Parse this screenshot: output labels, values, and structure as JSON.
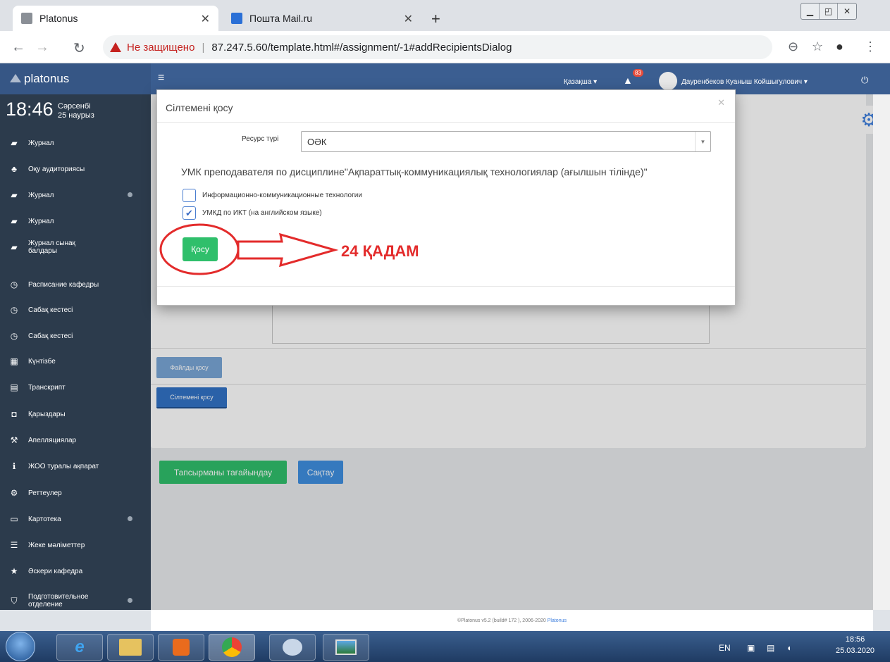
{
  "browser": {
    "tabs": [
      {
        "title": "Platonus",
        "active": true
      },
      {
        "title": "Пошта Mail.ru",
        "active": false
      }
    ],
    "address": {
      "warning": "Не защищено",
      "url": "87.247.5.60/template.html#/assignment/-1#addRecipientsDialog"
    }
  },
  "header": {
    "logo": "platonus",
    "language": "Қазақша ▾",
    "notifications_count": "83",
    "user": "Дауренбеков Куаныш Койшыгулович ▾"
  },
  "sidebar": {
    "time": "18:46",
    "weekday": "Сәрсенбі",
    "date": "25 наурыз",
    "items": [
      {
        "label": "Журнал",
        "icon": "book-icon"
      },
      {
        "label": "Оқу аудиториясы",
        "icon": "users-icon"
      },
      {
        "label": "Журнал",
        "icon": "book-icon"
      },
      {
        "label": "Журнал",
        "icon": "book-icon"
      },
      {
        "label": "Журнал сынақ балдары",
        "icon": "book-icon"
      },
      {
        "label": "Расписание кафедры",
        "icon": "clock-icon"
      },
      {
        "label": "Сабақ кестесі",
        "icon": "clock-icon"
      },
      {
        "label": "Сабақ кестесі",
        "icon": "clock-icon"
      },
      {
        "label": "Күнтізбе",
        "icon": "calendar-icon"
      },
      {
        "label": "Транскрипт",
        "icon": "table-icon"
      },
      {
        "label": "Қарыздары",
        "icon": "inbox-icon"
      },
      {
        "label": "Апелляциялар",
        "icon": "gavel-icon"
      },
      {
        "label": "ЖОО туралы ақпарат",
        "icon": "info-icon"
      },
      {
        "label": "Реттеулер",
        "icon": "cogs-icon"
      },
      {
        "label": "Картотека",
        "icon": "folder-icon"
      },
      {
        "label": "Жеке мәліметтер",
        "icon": "list-icon"
      },
      {
        "label": "Әскери кафедра",
        "icon": "star-icon"
      },
      {
        "label": "Подготовительное отделение",
        "icon": "shield-icon"
      }
    ]
  },
  "main": {
    "files_button": "Файлды қосу",
    "link_button": "Сілтемені қосу",
    "assign_button": "Тапсырманы тағайындау",
    "save_button": "Сақтау",
    "footer_text": "©Platonus v5.2 (build# 172 ), 2006-2020",
    "footer_link": "Platonus"
  },
  "modal": {
    "title": "Сілтемені қосу",
    "resource_label": "Ресурс түрі",
    "resource_value": "ОӘК",
    "description": "УМК преподавателя по дисциплине\"Ақпараттық-коммуникациялық технологиялар (ағылшын тілінде)\"",
    "options": [
      {
        "label": "Информационно-коммуникационные технологии",
        "checked": false
      },
      {
        "label": "УМКД по ИКТ (на английском языке)",
        "checked": true
      }
    ],
    "add_button": "Қосу"
  },
  "annotation": {
    "step_label": "24 ҚАДАМ",
    "color": "#e32b2b"
  },
  "taskbar": {
    "lang": "EN",
    "time": "18:56",
    "date": "25.03.2020"
  }
}
